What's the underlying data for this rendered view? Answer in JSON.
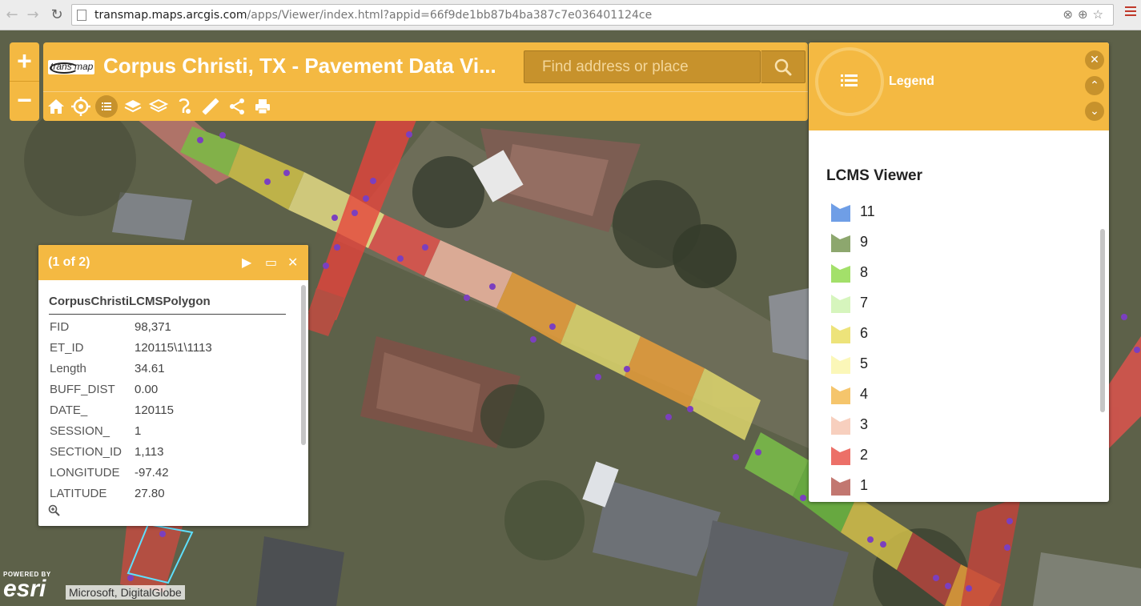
{
  "browser": {
    "url_host": "transmap.maps.arcgis.com",
    "url_path": "/apps/Viewer/index.html?appid=66f9de1bb87b4ba387c7e036401124ce"
  },
  "zoom": {
    "in_label": "+",
    "out_label": "−"
  },
  "header": {
    "logo_text": "trans map",
    "title": "Corpus Christi, TX - Pavement Data Vi...",
    "search_placeholder": "Find address or place",
    "tools": [
      "home-icon",
      "locate-icon",
      "legend-icon",
      "layers-icon",
      "basemap-icon",
      "measure-area-icon",
      "ruler-icon",
      "share-icon",
      "print-icon"
    ]
  },
  "popup": {
    "count": "(1 of 2)",
    "feature_title": "CorpusChristiLCMSPolygon",
    "attributes": [
      {
        "key": "FID",
        "value": "98,371"
      },
      {
        "key": "ET_ID",
        "value": "120115\\1\\1113"
      },
      {
        "key": "Length",
        "value": "34.61"
      },
      {
        "key": "BUFF_DIST",
        "value": "0.00"
      },
      {
        "key": "DATE_",
        "value": "120115"
      },
      {
        "key": "SESSION_",
        "value": "1"
      },
      {
        "key": "SECTION_ID",
        "value": "1,113"
      },
      {
        "key": "LONGITUDE",
        "value": "-97.42"
      },
      {
        "key": "LATITUDE",
        "value": "27.80"
      }
    ]
  },
  "legend": {
    "panel_title": "Legend",
    "layer_title": "LCMS Viewer",
    "items": [
      {
        "label": "11",
        "color": "#6f9ee6"
      },
      {
        "label": "9",
        "color": "#8da76e"
      },
      {
        "label": "8",
        "color": "#a3e06a"
      },
      {
        "label": "7",
        "color": "#d6f5bd"
      },
      {
        "label": "6",
        "color": "#ede37a"
      },
      {
        "label": "5",
        "color": "#fbf7b8"
      },
      {
        "label": "4",
        "color": "#f5c56c"
      },
      {
        "label": "3",
        "color": "#f7cfbe"
      },
      {
        "label": "2",
        "color": "#ec7068"
      },
      {
        "label": "1",
        "color": "#c27770"
      }
    ]
  },
  "attribution": {
    "powered_by": "POWERED BY",
    "brand": "esri",
    "credits": "Microsoft, DigitalGlobe"
  },
  "colors": {
    "accent": "#f4b942",
    "accent_dark": "#c7922c",
    "point": "#7b3fbf",
    "selection": "#5ee0ff"
  }
}
